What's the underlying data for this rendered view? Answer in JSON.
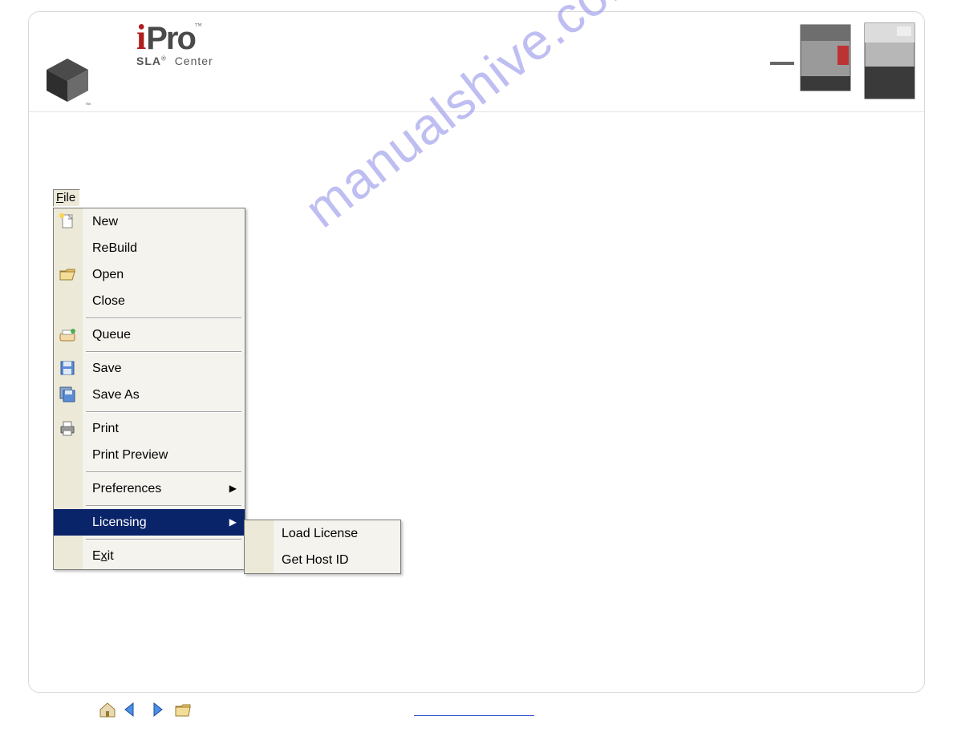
{
  "header": {
    "brand_i": "i",
    "brand_pro": "Pro",
    "brand_tm": "™",
    "brand_sub_left": "SLA",
    "brand_sub_reg": "®",
    "brand_sub_right": "Center"
  },
  "menubar": {
    "file_label_u": "F",
    "file_label_rest": "ile"
  },
  "file_menu": {
    "new": "New",
    "rebuild": "ReBuild",
    "open": "Open",
    "close": "Close",
    "queue": "Queue",
    "save": "Save",
    "save_as": "Save As",
    "print": "Print",
    "print_preview": "Print Preview",
    "preferences": "Preferences",
    "licensing": "Licensing",
    "exit_pre": "E",
    "exit_u": "x",
    "exit_post": "it"
  },
  "licensing_submenu": {
    "load_license": "Load License",
    "get_host_id": "Get Host ID"
  },
  "watermark": "manualshive.com",
  "icons": {
    "new": "new-file-icon",
    "open": "open-folder-icon",
    "queue": "queue-icon",
    "save": "save-disk-icon",
    "save_as": "save-multi-disk-icon",
    "print": "printer-icon",
    "home": "home-icon",
    "prev": "prev-arrow-icon",
    "next": "next-arrow-icon",
    "folder": "folder-icon"
  }
}
